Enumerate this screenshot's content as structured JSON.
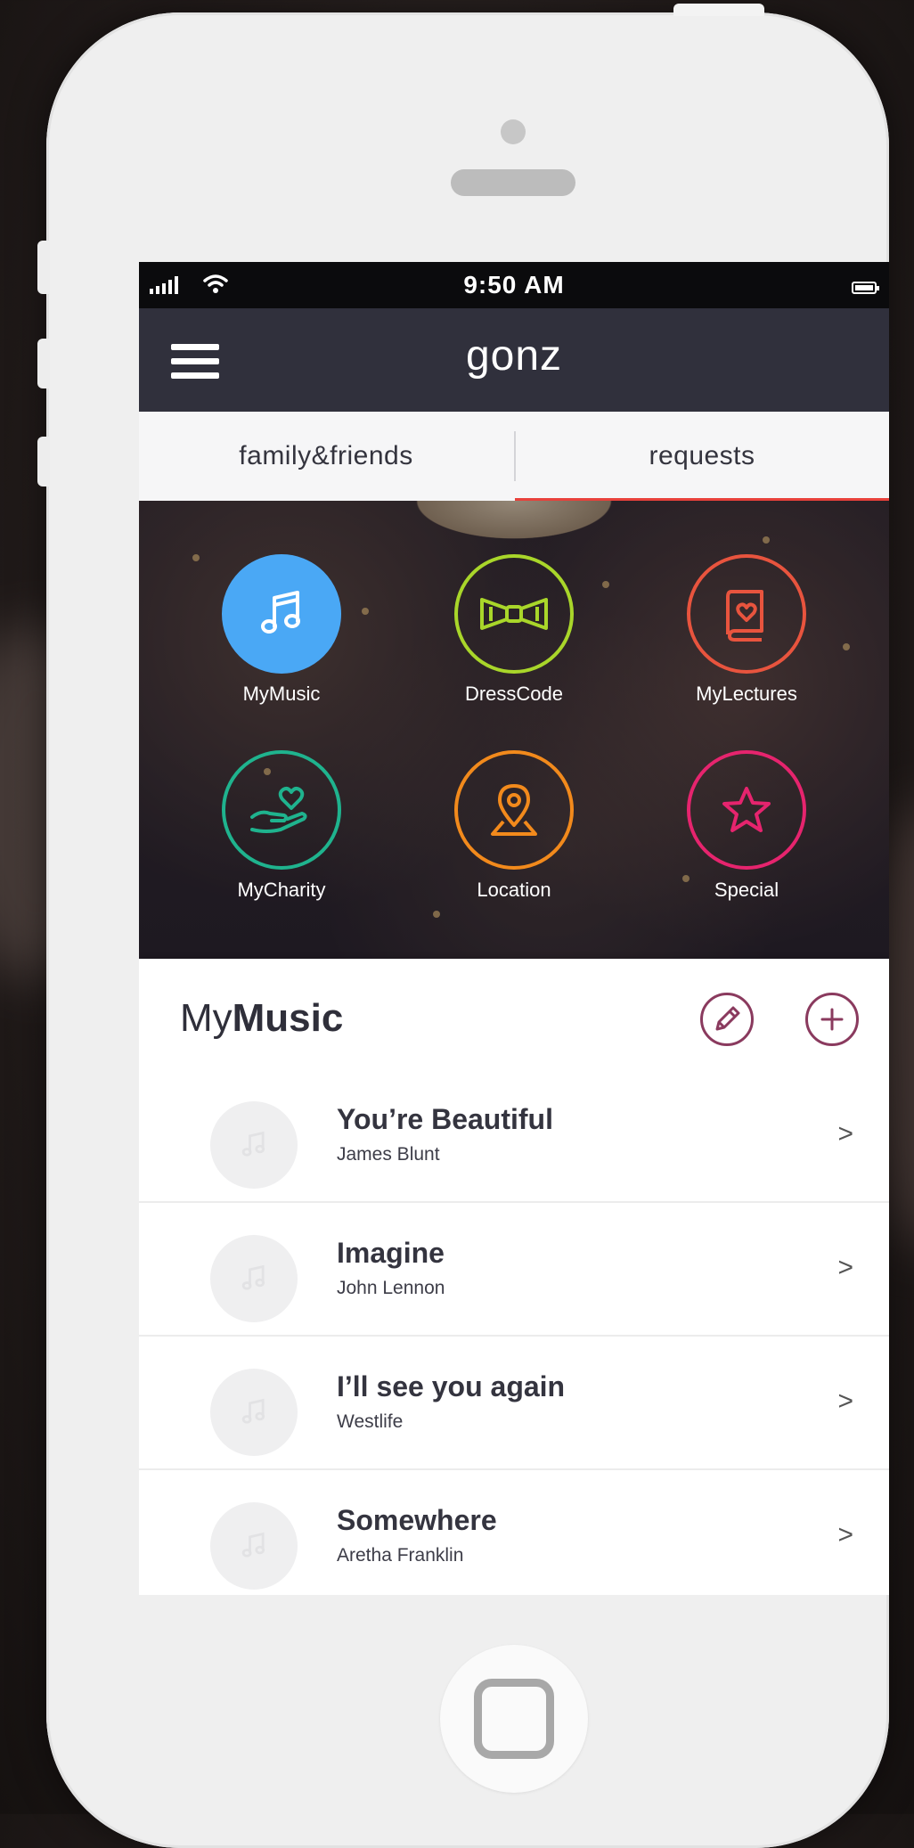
{
  "status_bar": {
    "time": "9:50 AM"
  },
  "header": {
    "app_title": "gonz"
  },
  "tabs": [
    {
      "label": "family&friends",
      "active": false
    },
    {
      "label": "requests",
      "active": true
    }
  ],
  "categories": [
    {
      "label": "MyMusic",
      "icon": "music-note-icon",
      "color": "#4aa8f5",
      "filled": true
    },
    {
      "label": "DressCode",
      "icon": "bow-tie-icon",
      "color": "#a9d62a",
      "filled": false
    },
    {
      "label": "MyLectures",
      "icon": "book-heart-icon",
      "color": "#e8543e",
      "filled": false
    },
    {
      "label": "MyCharity",
      "icon": "hand-heart-icon",
      "color": "#1fb38e",
      "filled": false
    },
    {
      "label": "Location",
      "icon": "map-pin-icon",
      "color": "#f28a1c",
      "filled": false
    },
    {
      "label": "Special",
      "icon": "star-icon",
      "color": "#e6246e",
      "filled": false
    }
  ],
  "section": {
    "title_light": "My",
    "title_bold": "Music",
    "accent": "#8a3a5e"
  },
  "songs": [
    {
      "title": "You’re Beautiful",
      "artist": "James Blunt",
      "chevron": ">"
    },
    {
      "title": "Imagine",
      "artist": "John Lennon",
      "chevron": ">"
    },
    {
      "title": "I’ll see you again",
      "artist": "Westlife",
      "chevron": ">"
    },
    {
      "title": "Somewhere",
      "artist": "Aretha Franklin",
      "chevron": ">"
    }
  ]
}
